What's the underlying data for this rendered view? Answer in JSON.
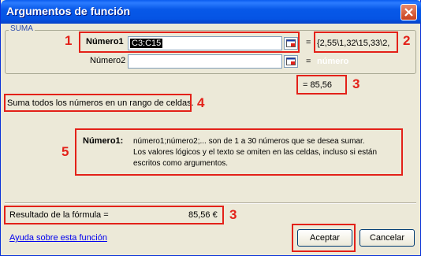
{
  "window": {
    "title": "Argumentos de función"
  },
  "group": {
    "title": "SUMA"
  },
  "args": [
    {
      "label": "Número1",
      "value": "C3:C15",
      "result": "{2,55\\1,32\\15,33\\2,"
    },
    {
      "label": "Número2",
      "value": "",
      "result": "número"
    }
  ],
  "preview_result": "= 85,56",
  "function_description": "Suma todos los números en un rango de celdas.",
  "arg_help": {
    "label": "Número1:",
    "lines": [
      "número1;número2;... son de 1 a 30 números que se desea sumar.",
      "Los valores lógicos y el texto se omiten en las celdas, incluso si están",
      "escritos como argumentos."
    ]
  },
  "formula_result": {
    "label": "Resultado de la fórmula =",
    "value": "85,56 €"
  },
  "help_link": "Ayuda sobre esta función",
  "buttons": {
    "ok": "Aceptar",
    "cancel": "Cancelar"
  },
  "annotations": [
    "1",
    "2",
    "3",
    "4",
    "5",
    "3"
  ],
  "colors": {
    "annotation": "#e32119",
    "titlebar": "#0554e4",
    "dialog_bg": "#ece9d8"
  },
  "icons": [
    "close-icon",
    "collapse-dialog-icon"
  ]
}
